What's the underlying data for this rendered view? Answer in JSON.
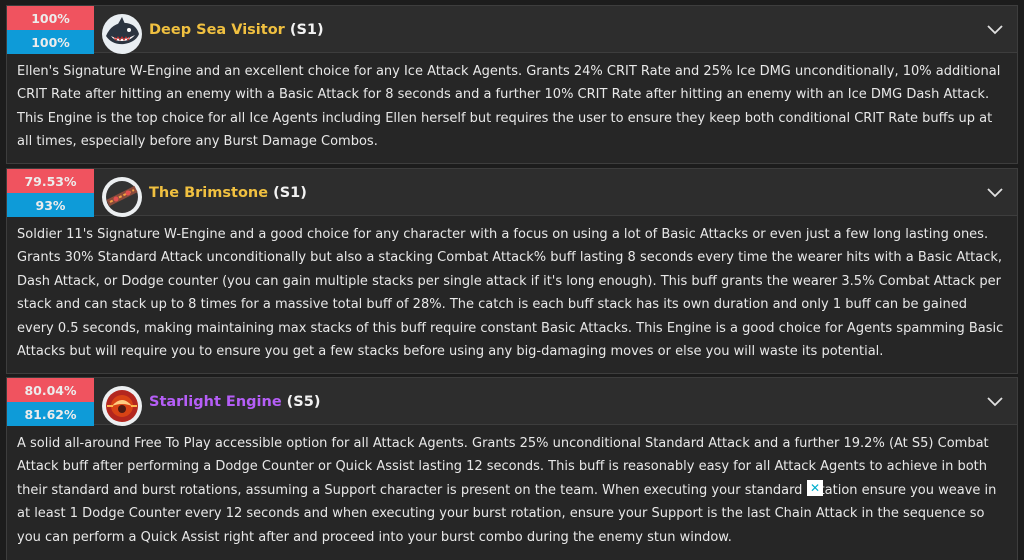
{
  "colors": {
    "red": "#f0535f",
    "blue": "#0e9bd8",
    "gold": "#f0c040",
    "purple": "#b55ef7"
  },
  "engines": [
    {
      "score_top": "100%",
      "score_bottom": "100%",
      "name": "Deep Sea Visitor",
      "tier": "(S1)",
      "name_color": "#f0c040",
      "icon": "shark-w-engine-icon",
      "description": "Ellen's Signature W-Engine and an excellent choice for any Ice Attack Agents. Grants 24% CRIT Rate and 25% Ice DMG unconditionally, 10% additional CRIT Rate after hitting an enemy with a Basic Attack for 8 seconds and a further 10% CRIT Rate after hitting an enemy with an Ice DMG Dash Attack. This Engine is the top choice for all Ice Agents including Ellen herself but requires the user to ensure they keep both conditional CRIT Rate buffs up at all times, especially before any Burst Damage Combos."
    },
    {
      "score_top": "79.53%",
      "score_bottom": "93%",
      "name": "The Brimstone",
      "tier": "(S1)",
      "name_color": "#f0c040",
      "icon": "brimstone-w-engine-icon",
      "description": "Soldier 11's Signature W-Engine and a good choice for any character with a focus on using a lot of Basic Attacks or even just a few long lasting ones. Grants 30% Standard Attack unconditionally but also a stacking Combat Attack% buff lasting 8 seconds every time the wearer hits with a Basic Attack, Dash Attack, or Dodge counter (you can gain multiple stacks per single attack if it's long enough). This buff grants the wearer 3.5% Combat Attack per stack and can stack up to 8 times for a massive total buff of 28%. The catch is each buff stack has its own duration and only 1 buff can be gained every 0.5 seconds, making maintaining max stacks of this buff require constant Basic Attacks. This Engine is a good choice for Agents spamming Basic Attacks but will require you to ensure you get a few stacks before using any big-damaging moves or else you will waste its potential."
    },
    {
      "score_top": "80.04%",
      "score_bottom": "81.62%",
      "name": "Starlight Engine",
      "tier": "(S5)",
      "name_color": "#b55ef7",
      "icon": "starlight-w-engine-icon",
      "description": "A solid all-around Free To Play accessible option for all Attack Agents. Grants 25% unconditional Standard Attack and a further 19.2% (At S5) Combat Attack buff after performing a Dodge Counter or Quick Assist lasting 12 seconds. This buff is reasonably easy for all Attack Agents to achieve in both their standard and burst rotations, assuming a Support character is present on the team. When executing your standard rotation ensure you weave in at least 1 Dodge Counter every 12 seconds and when executing your burst rotation, ensure your Support is the last Chain Attack in the sequence so you can perform a Quick Assist right after and proceed into your burst combo during the enemy stun window."
    }
  ]
}
